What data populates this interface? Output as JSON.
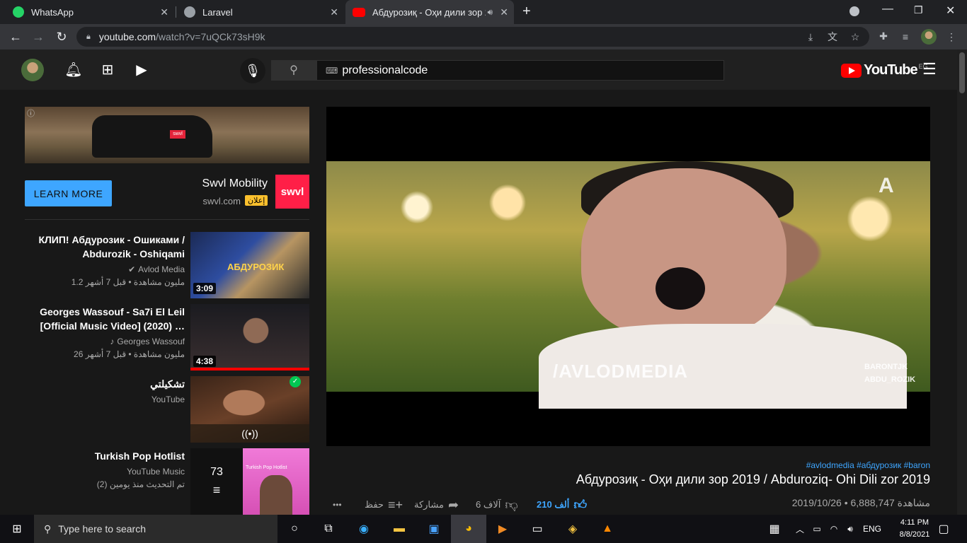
{
  "browser": {
    "tabs": [
      {
        "title": "WhatsApp",
        "favicon_color": "#25d366"
      },
      {
        "title": "Laravel",
        "favicon_color": "#9aa0a6"
      },
      {
        "title": "Абдурозиқ - Оҳи дили зор 2",
        "favicon_color": "#ff0000"
      }
    ],
    "new_tab": "+",
    "url_host": "youtube.com",
    "url_path": "/watch?v=7uQCk73sH9k"
  },
  "youtube": {
    "search_value": "professionalcode",
    "logo_text": "YouTube",
    "country_code": "EG"
  },
  "ad": {
    "learn_more": "LEARN MORE",
    "advertiser": "Swvl Mobility",
    "domain": "swvl.com",
    "badge": "إعلان",
    "logo_text": "swvl",
    "van_text": "swvl",
    "info_icon": "ⓘ"
  },
  "related": [
    {
      "title": "КЛИП! Абдурозик - Ошиками / Abdurozik - Oshiqami",
      "channel": "Avlod Media",
      "meta": "1.2 مليون مشاهدة • قبل 7 أشهر",
      "duration": "3:09",
      "thumb_text": "АБДУРОЗИК"
    },
    {
      "title": "Georges Wassouf - Sa7i El Leil [Official Music Video] (2020) …",
      "channel": "Georges Wassouf",
      "meta": "26 مليون مشاهدة • قبل 7 أشهر",
      "duration": "4:38"
    },
    {
      "title": "تشكيلتي",
      "channel": "YouTube"
    },
    {
      "title": "Turkish Pop Hotlist",
      "channel": "YouTube Music",
      "meta": "تم التحديث منذ يومين (2)",
      "count": "73",
      "thumb_text": "Turkish Pop Hotlist"
    }
  ],
  "video": {
    "hashtags": "#avlodmedia #абдурозик #baron",
    "title": "Абдурозиқ - Оҳи дили зор 2019 / Abduroziq- Ohi Dili zor 2019",
    "meta": "2019/10/26 • مشاهدة 6,888,747",
    "likes": "210 ألف",
    "dislikes": "6 آلاف",
    "share": "مشاركة",
    "save": "حفظ",
    "more": "•••",
    "watermark": "/AVLODMEDIA",
    "handles": [
      "BARONTJK",
      "ABDU_ROZIK"
    ]
  },
  "taskbar": {
    "search_placeholder": "Type here to search",
    "language": "ENG",
    "time": "4:11 PM",
    "date": "8/8/2021"
  }
}
